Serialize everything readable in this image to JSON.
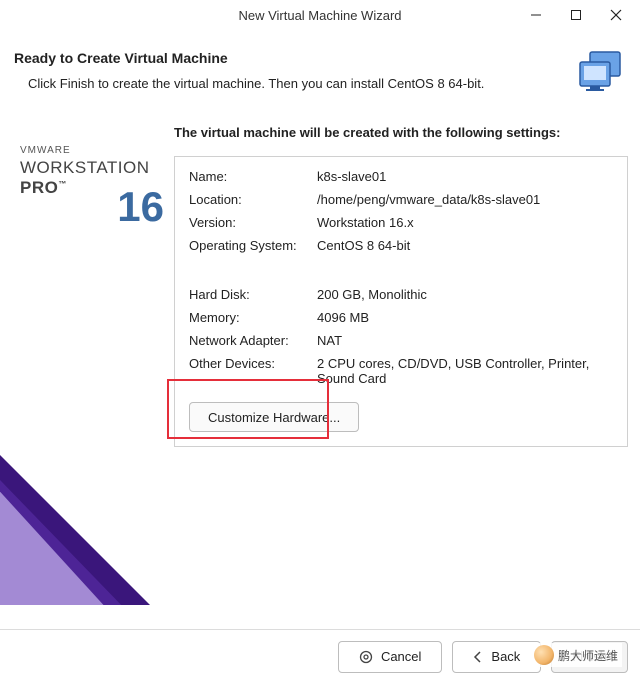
{
  "window": {
    "title": "New Virtual Machine Wizard"
  },
  "header": {
    "title": "Ready to Create Virtual Machine",
    "subtitle": "Click Finish to create the virtual machine. Then you can install CentOS 8 64-bit."
  },
  "brand": {
    "line1": "VMWARE",
    "line2": "WORKSTATION",
    "line3_pro": "PRO",
    "line3_tm": "™",
    "version_big": "16"
  },
  "settings": {
    "intro": "The virtual machine will be created with the following settings:",
    "rows_a": [
      {
        "key": "Name:",
        "val": "k8s-slave01"
      },
      {
        "key": "Location:",
        "val": "/home/peng/vmware_data/k8s-slave01"
      },
      {
        "key": "Version:",
        "val": "Workstation 16.x"
      },
      {
        "key": "Operating System:",
        "val": "CentOS 8 64-bit"
      }
    ],
    "rows_b": [
      {
        "key": "Hard Disk:",
        "val": "200 GB, Monolithic"
      },
      {
        "key": "Memory:",
        "val": "4096 MB"
      },
      {
        "key": "Network Adapter:",
        "val": "NAT"
      },
      {
        "key": "Other Devices:",
        "val": "2 CPU cores, CD/DVD, USB Controller, Printer, Sound Card"
      }
    ],
    "customize_label": "Customize Hardware..."
  },
  "footer": {
    "cancel": "Cancel",
    "back": "Back",
    "finish": "Finish"
  },
  "watermark": {
    "text": "鹏大师运维"
  }
}
